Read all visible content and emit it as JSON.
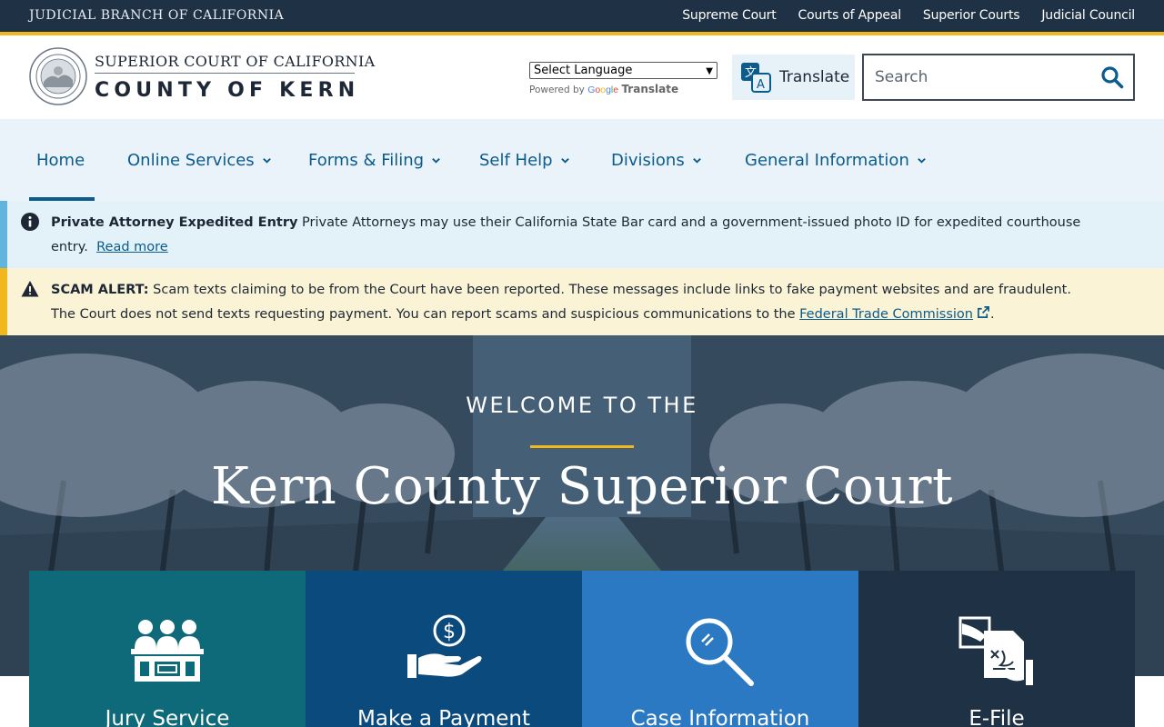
{
  "topbar": {
    "brand": "JUDICIAL BRANCH OF CALIFORNIA",
    "links": [
      "Supreme Court",
      "Courts of Appeal",
      "Superior Courts",
      "Judicial Council"
    ]
  },
  "header": {
    "logo_line1": "SUPERIOR COURT OF CALIFORNIA",
    "logo_line2": "COUNTY OF KERN",
    "language_select": "Select Language",
    "powered_by": "Powered by",
    "google": "Google",
    "powered_translate": "Translate",
    "translate_button": "Translate",
    "search_placeholder": "Search"
  },
  "nav": {
    "items": [
      {
        "label": "Home",
        "active": true,
        "dropdown": false
      },
      {
        "label": "Online Services",
        "dropdown": true
      },
      {
        "label": "Forms & Filing",
        "dropdown": true
      },
      {
        "label": "Self Help",
        "dropdown": true
      },
      {
        "label": "Divisions",
        "dropdown": true
      },
      {
        "label": "General Information",
        "dropdown": true
      }
    ]
  },
  "alerts": {
    "info": {
      "icon": "info-icon",
      "title": "Private Attorney Expedited Entry",
      "text": " Private Attorneys may use their California State Bar card and a government-issued photo ID for expedited courthouse entry.",
      "link": "Read more"
    },
    "scam": {
      "icon": "warning-icon",
      "title": "SCAM ALERT:",
      "text": " Scam texts claiming to be from the Court have been reported. These messages include links to fake payment websites and are fraudulent. The Court does not send texts requesting payment. You can report scams and suspicious communications to the ",
      "link": "Federal Trade Commission",
      "suffix": "."
    }
  },
  "hero": {
    "kicker": "WELCOME TO THE",
    "title": "Kern County Superior Court"
  },
  "tiles": [
    {
      "label": "Jury Service",
      "icon": "jury-icon"
    },
    {
      "label": "Make a Payment",
      "icon": "payment-icon"
    },
    {
      "label": "Case Information",
      "icon": "case-search-icon"
    },
    {
      "label": "E-File",
      "icon": "efile-icon"
    }
  ],
  "colors": {
    "topbar": "#1f3145",
    "gold": "#f1b81e",
    "nav_bg": "#eaf3f9",
    "link_blue": "#0b5b8c",
    "tile_jury": "#0e6a79",
    "tile_payment": "#0b4a7c",
    "tile_case": "#2b79c2",
    "tile_efile": "#1f3145"
  }
}
